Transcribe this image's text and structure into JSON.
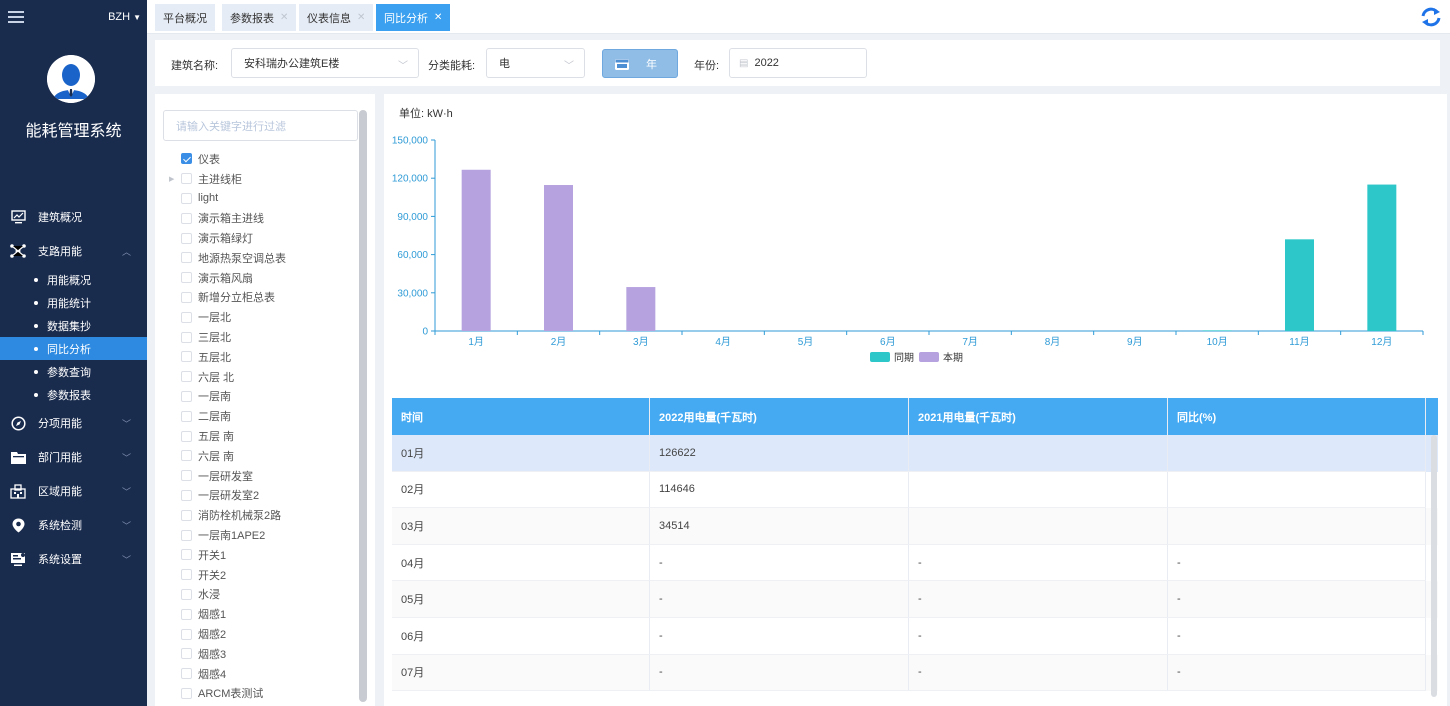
{
  "sidebar": {
    "user": "BZH",
    "app_title": "能耗管理系统",
    "menu": [
      {
        "label": "建筑概况",
        "icon": "monitor-icon",
        "arrow": ""
      },
      {
        "label": "支路用能",
        "icon": "network-icon",
        "arrow": "︿"
      },
      {
        "label": "分项用能",
        "icon": "compass-icon",
        "arrow": "﹀"
      },
      {
        "label": "部门用能",
        "icon": "folder-icon",
        "arrow": "﹀"
      },
      {
        "label": "区域用能",
        "icon": "building-icon",
        "arrow": "﹀"
      },
      {
        "label": "系统检测",
        "icon": "location-icon",
        "arrow": "﹀"
      },
      {
        "label": "系统设置",
        "icon": "settings-screen-icon",
        "arrow": "﹀"
      }
    ],
    "submenu": [
      "用能概况",
      "用能统计",
      "数据集抄",
      "同比分析",
      "参数查询",
      "参数报表"
    ],
    "active_sub": "同比分析"
  },
  "tabs": [
    {
      "label": "平台概况",
      "closable": false
    },
    {
      "label": "参数报表",
      "closable": true
    },
    {
      "label": "仪表信息",
      "closable": true
    },
    {
      "label": "同比分析",
      "closable": true,
      "active": true
    }
  ],
  "filters": {
    "building_label": "建筑名称:",
    "building_value": "安科瑞办公建筑E楼",
    "category_label": "分类能耗:",
    "category_value": "电",
    "period_button": "年",
    "year_label": "年份:",
    "year_value": "2022"
  },
  "tree": {
    "search_placeholder": "请输入关键字进行过滤",
    "nodes": [
      {
        "label": "仪表",
        "checked": true,
        "expandable": false,
        "indent": 0
      },
      {
        "label": "主进线柜",
        "checked": false,
        "expandable": true,
        "indent": 0
      },
      {
        "label": "light",
        "checked": false,
        "indent": 1
      },
      {
        "label": "演示箱主进线",
        "checked": false,
        "indent": 1
      },
      {
        "label": "演示箱绿灯",
        "checked": false,
        "indent": 1
      },
      {
        "label": "地源热泵空调总表",
        "checked": false,
        "indent": 1
      },
      {
        "label": "演示箱风扇",
        "checked": false,
        "indent": 1
      },
      {
        "label": "新增分立柜总表",
        "checked": false,
        "indent": 1
      },
      {
        "label": "一层北",
        "checked": false,
        "indent": 1
      },
      {
        "label": "三层北",
        "checked": false,
        "indent": 1
      },
      {
        "label": "五层北",
        "checked": false,
        "indent": 1
      },
      {
        "label": "六层 北",
        "checked": false,
        "indent": 1
      },
      {
        "label": "一层南",
        "checked": false,
        "indent": 1
      },
      {
        "label": "二层南",
        "checked": false,
        "indent": 1
      },
      {
        "label": "五层 南",
        "checked": false,
        "indent": 1
      },
      {
        "label": "六层 南",
        "checked": false,
        "indent": 1
      },
      {
        "label": "一层研发室",
        "checked": false,
        "indent": 1
      },
      {
        "label": "一层研发室2",
        "checked": false,
        "indent": 1
      },
      {
        "label": "消防栓机械泵2路",
        "checked": false,
        "indent": 1
      },
      {
        "label": "一层南1APE2",
        "checked": false,
        "indent": 1
      },
      {
        "label": "开关1",
        "checked": false,
        "indent": 1
      },
      {
        "label": "开关2",
        "checked": false,
        "indent": 1
      },
      {
        "label": "水浸",
        "checked": false,
        "indent": 1
      },
      {
        "label": "烟感1",
        "checked": false,
        "indent": 1
      },
      {
        "label": "烟感2",
        "checked": false,
        "indent": 1
      },
      {
        "label": "烟感3",
        "checked": false,
        "indent": 1
      },
      {
        "label": "烟感4",
        "checked": false,
        "indent": 1
      },
      {
        "label": "ARCM表测试",
        "checked": false,
        "indent": 1
      }
    ]
  },
  "chart_unit": "单位: kW·h",
  "chart_data": {
    "type": "bar",
    "categories": [
      "1月",
      "2月",
      "3月",
      "4月",
      "5月",
      "6月",
      "7月",
      "8月",
      "9月",
      "10月",
      "11月",
      "12月"
    ],
    "series": [
      {
        "name": "同期",
        "color": "#2ec7c9",
        "values": [
          0,
          0,
          0,
          0,
          0,
          0,
          0,
          0,
          0,
          500,
          72000,
          115000
        ]
      },
      {
        "name": "本期",
        "color": "#b6a2de",
        "values": [
          126622,
          114646,
          34514,
          0,
          0,
          0,
          0,
          0,
          0,
          0,
          0,
          0
        ]
      }
    ],
    "yticks": [
      "0",
      "30,000",
      "60,000",
      "90,000",
      "120,000",
      "150,000"
    ],
    "ylim": [
      0,
      150000
    ],
    "legend": "bottom-center"
  },
  "table": {
    "headers": [
      "时间",
      "2022用电量(千瓦时)",
      "2021用电量(千瓦时)",
      "同比(%)"
    ],
    "rows": [
      [
        "01月",
        "126622",
        "",
        ""
      ],
      [
        "02月",
        "114646",
        "",
        ""
      ],
      [
        "03月",
        "34514",
        "",
        ""
      ],
      [
        "04月",
        "-",
        "-",
        "-"
      ],
      [
        "05月",
        "-",
        "-",
        "-"
      ],
      [
        "06月",
        "-",
        "-",
        "-"
      ],
      [
        "07月",
        "-",
        "-",
        "-"
      ]
    ]
  }
}
